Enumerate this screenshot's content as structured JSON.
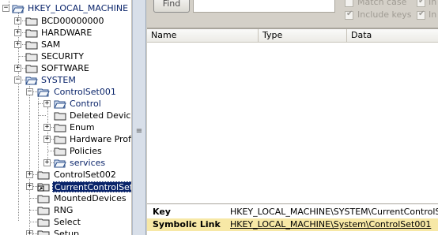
{
  "tree": {
    "root": {
      "label": "HKEY_LOCAL_MACHINE"
    },
    "hklm_children": [
      {
        "label": "BCD00000000"
      },
      {
        "label": "HARDWARE"
      },
      {
        "label": "SAM"
      },
      {
        "label": "SECURITY"
      },
      {
        "label": "SOFTWARE"
      },
      {
        "label": "SYSTEM"
      }
    ],
    "system_children": [
      {
        "label": "ControlSet001"
      },
      {
        "label": "ControlSet002"
      },
      {
        "label": "CurrentControlSet"
      },
      {
        "label": "MountedDevices"
      },
      {
        "label": "RNG"
      },
      {
        "label": "Select"
      },
      {
        "label": "Setup"
      }
    ],
    "controlset001_children": [
      {
        "label": "Control"
      },
      {
        "label": "Deleted Device ID"
      },
      {
        "label": "Enum"
      },
      {
        "label": "Hardware Profile"
      },
      {
        "label": "Policies"
      },
      {
        "label": "services"
      }
    ]
  },
  "search": {
    "find_label": "Find",
    "options": [
      {
        "label": "Match case",
        "checked": false
      },
      {
        "label": "Include keys",
        "checked": true
      },
      {
        "label": "In",
        "checked": true
      },
      {
        "label": "In",
        "checked": true
      }
    ]
  },
  "list": {
    "columns": [
      "Name",
      "Type",
      "Data"
    ]
  },
  "details": {
    "key_label": "Key",
    "key_value": "HKEY_LOCAL_MACHINE\\SYSTEM\\CurrentControlSet\\",
    "symlink_label": "Symbolic Link",
    "symlink_value": "HKEY_LOCAL_MACHINE\\System\\ControlSet001"
  },
  "colors": {
    "selection": "#0a246a",
    "link_row_highlight": "#f7e8a6",
    "folder_yellow": "#f3d36b"
  }
}
